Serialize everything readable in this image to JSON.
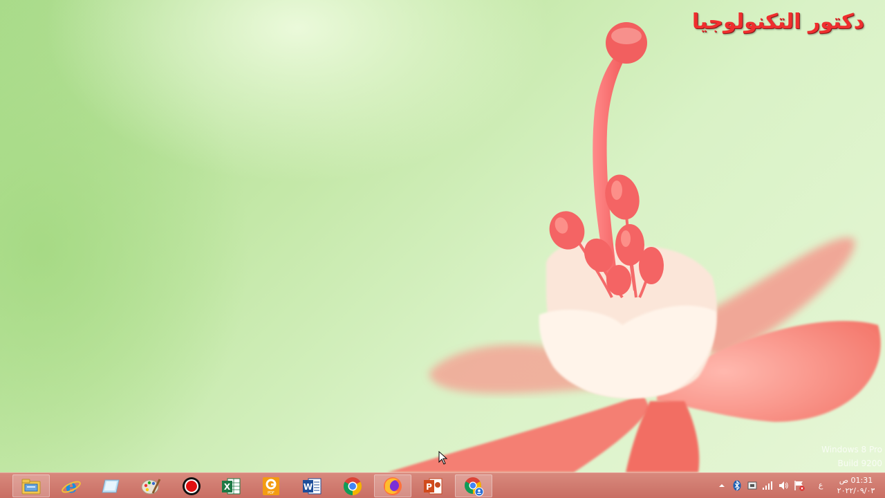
{
  "desktop": {
    "watermark_text": "دكتور التكنولوجيا",
    "windows_version_line1": "Windows 8 Pro",
    "windows_version_line2": "Build 9200"
  },
  "taskbar": {
    "pinned_apps": [
      {
        "name": "File Explorer",
        "icon": "file-explorer-icon",
        "active": true
      },
      {
        "name": "Internet Explorer",
        "icon": "internet-explorer-icon",
        "active": false
      },
      {
        "name": "Desktop",
        "icon": "desktop-icon",
        "active": false
      },
      {
        "name": "Paint",
        "icon": "paint-icon",
        "active": false
      },
      {
        "name": "Screen Recorder",
        "icon": "record-icon",
        "active": false
      },
      {
        "name": "Excel",
        "icon": "excel-icon",
        "active": false
      },
      {
        "name": "PDF",
        "icon": "pdf-icon",
        "active": false
      },
      {
        "name": "Word",
        "icon": "word-icon",
        "active": false
      },
      {
        "name": "Chrome",
        "icon": "chrome-icon",
        "active": false
      },
      {
        "name": "Firefox",
        "icon": "firefox-icon",
        "active": true
      },
      {
        "name": "PowerPoint",
        "icon": "powerpoint-icon",
        "active": false
      },
      {
        "name": "Chrome Profile",
        "icon": "chrome-profile-icon",
        "active": true
      }
    ],
    "tray": {
      "language": "ع",
      "clock_time": "01:31 ص",
      "clock_date": "٢٠٢٢/٠٩/٠٣"
    }
  },
  "colors": {
    "taskbar": "#c96e63",
    "watermark": "#ef2e2e",
    "desktop": "#c4e8a8"
  }
}
